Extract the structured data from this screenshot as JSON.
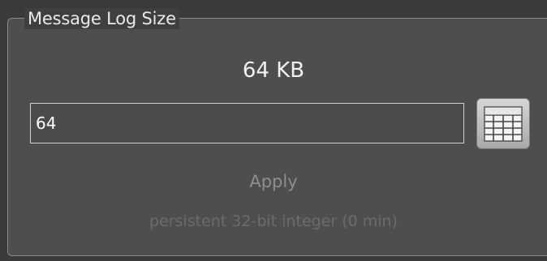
{
  "group": {
    "title": "Message Log Size"
  },
  "display": {
    "value_text": "64 KB"
  },
  "input": {
    "value": "64"
  },
  "keypad_button": {
    "icon": "keypad-icon"
  },
  "actions": {
    "apply_label": "Apply"
  },
  "hint": {
    "text": "persistent 32-bit integer (0 min)"
  },
  "colors": {
    "background": "#3a3a3a",
    "panel": "#4e4e4e",
    "border": "#8a8a8a",
    "disabled_text": "#8e8e8e"
  }
}
